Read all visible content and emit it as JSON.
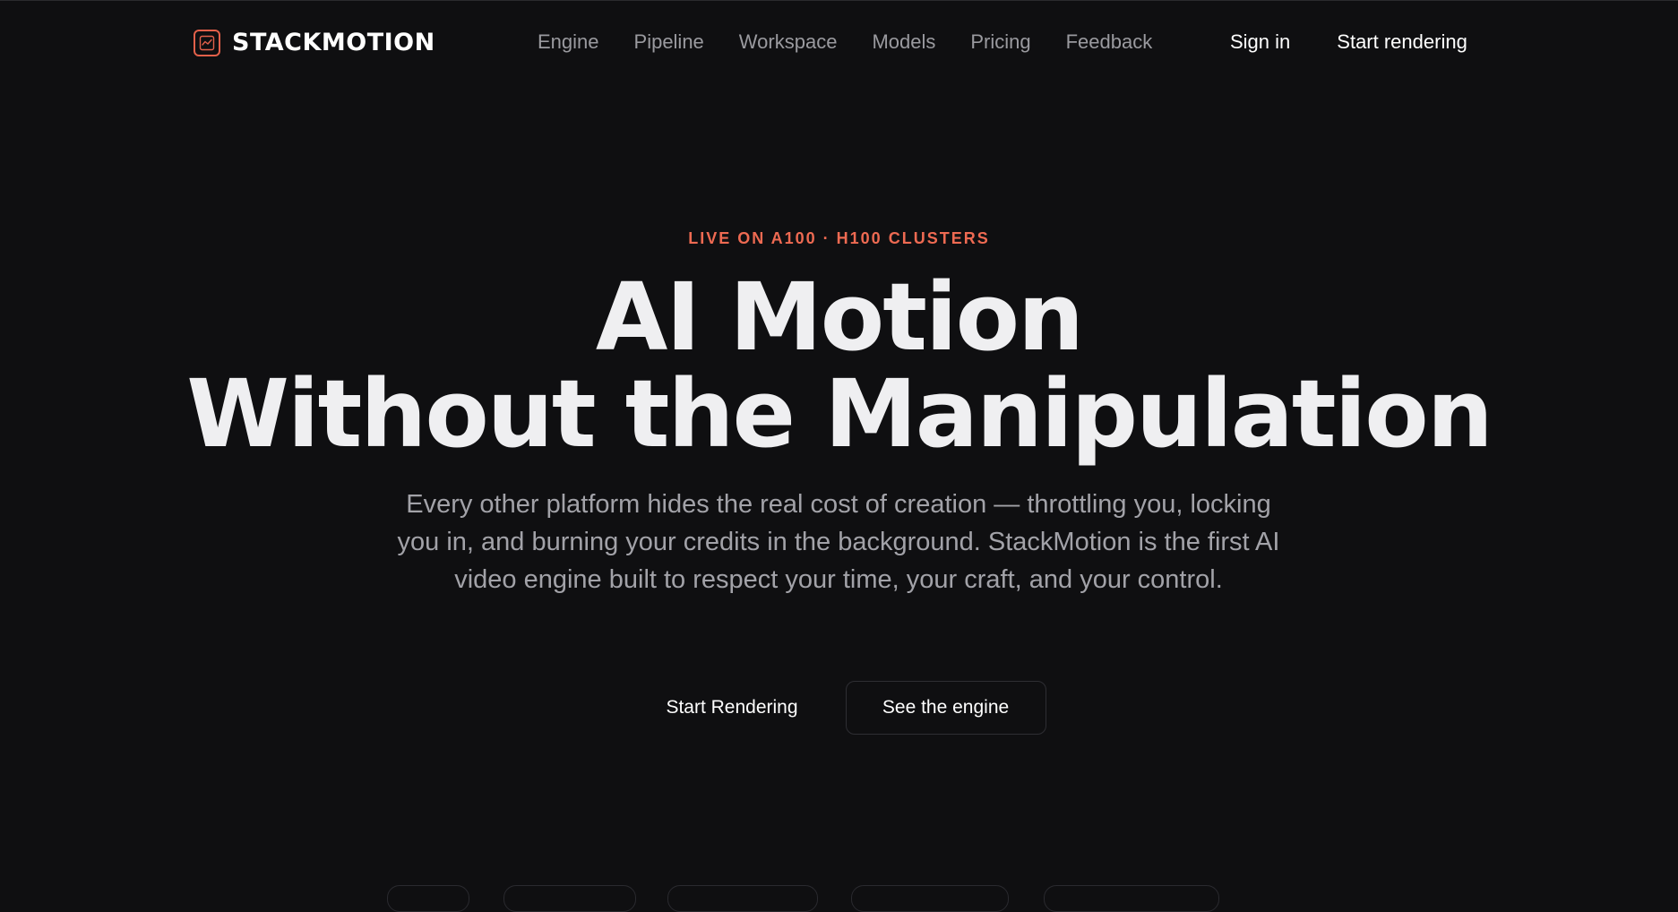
{
  "brand": {
    "name": "STACKMOTION",
    "icon": "chart-line-icon",
    "accent_color": "#e2604a"
  },
  "nav": {
    "links": [
      "Engine",
      "Pipeline",
      "Workspace",
      "Models",
      "Pricing",
      "Feedback"
    ],
    "sign_in": "Sign in",
    "cta": "Start rendering"
  },
  "hero": {
    "eyebrow": "LIVE ON A100 · H100 CLUSTERS",
    "headline_line1": "AI Motion",
    "headline_line2": "Without the Manipulation",
    "subtext": "Every other platform hides the real cost of creation — throttling you, locking you in, and burning your credits in the background. StackMotion is the first AI video engine built to respect your time, your craft, and your control.",
    "primary_button": "Start Rendering",
    "secondary_button": "See the engine",
    "eyebrow_color": "#ee6a52"
  }
}
